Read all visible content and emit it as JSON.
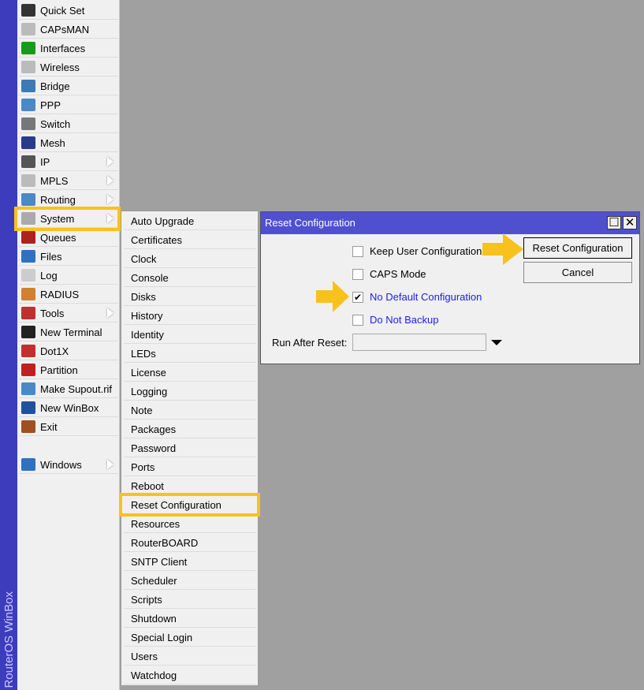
{
  "app": {
    "side_label": "RouterOS WinBox"
  },
  "menu": {
    "items": [
      {
        "label": "Quick Set",
        "icon": "wand-icon",
        "color": "#333"
      },
      {
        "label": "CAPsMAN",
        "icon": "antenna-icon",
        "color": "#bbb"
      },
      {
        "label": "Interfaces",
        "icon": "nic-icon",
        "color": "#1a9a1a"
      },
      {
        "label": "Wireless",
        "icon": "antenna-icon",
        "color": "#bbb"
      },
      {
        "label": "Bridge",
        "icon": "bridge-icon",
        "color": "#3d7ab8"
      },
      {
        "label": "PPP",
        "icon": "ppp-icon",
        "color": "#4a88c8"
      },
      {
        "label": "Switch",
        "icon": "switch-icon",
        "color": "#777"
      },
      {
        "label": "Mesh",
        "icon": "mesh-icon",
        "color": "#2a3a8a"
      },
      {
        "label": "IP",
        "icon": "ip-icon",
        "color": "#555",
        "sub": true
      },
      {
        "label": "MPLS",
        "icon": "mpls-icon",
        "color": "#bbb",
        "sub": true
      },
      {
        "label": "Routing",
        "icon": "routing-icon",
        "color": "#4a88c8",
        "sub": true
      },
      {
        "label": "System",
        "icon": "gear-icon",
        "color": "#aaa",
        "sub": true
      },
      {
        "label": "Queues",
        "icon": "queues-icon",
        "color": "#b02020"
      },
      {
        "label": "Files",
        "icon": "folder-icon",
        "color": "#3070c0"
      },
      {
        "label": "Log",
        "icon": "log-icon",
        "color": "#ccc"
      },
      {
        "label": "RADIUS",
        "icon": "users-icon",
        "color": "#d08030"
      },
      {
        "label": "Tools",
        "icon": "tools-icon",
        "color": "#c03030",
        "sub": true
      },
      {
        "label": "New Terminal",
        "icon": "terminal-icon",
        "color": "#222"
      },
      {
        "label": "Dot1X",
        "icon": "dot1x-icon",
        "color": "#c03030"
      },
      {
        "label": "Partition",
        "icon": "partition-icon",
        "color": "#c02020"
      },
      {
        "label": "Make Supout.rif",
        "icon": "supout-icon",
        "color": "#4a88c8"
      },
      {
        "label": "New WinBox",
        "icon": "winbox-icon",
        "color": "#2050a0"
      },
      {
        "label": "Exit",
        "icon": "exit-icon",
        "color": "#a05020"
      },
      {
        "label": "",
        "icon": "",
        "color": ""
      },
      {
        "label": "Windows",
        "icon": "windows-icon",
        "color": "#3070c0",
        "sub": true
      }
    ]
  },
  "submenu": {
    "items": [
      "Auto Upgrade",
      "Certificates",
      "Clock",
      "Console",
      "Disks",
      "History",
      "Identity",
      "LEDs",
      "License",
      "Logging",
      "Note",
      "Packages",
      "Password",
      "Ports",
      "Reboot",
      "Reset Configuration",
      "Resources",
      "RouterBOARD",
      "SNTP Client",
      "Scheduler",
      "Scripts",
      "Shutdown",
      "Special Login",
      "Users",
      "Watchdog"
    ]
  },
  "dialog": {
    "title": "Reset Configuration",
    "keep_user": {
      "label": "Keep User Configuration",
      "checked": false
    },
    "caps_mode": {
      "label": "CAPS Mode",
      "checked": false
    },
    "no_default": {
      "label": "No Default Configuration",
      "checked": true
    },
    "no_backup": {
      "label": "Do Not Backup",
      "checked": false
    },
    "run_after_label": "Run After Reset:",
    "run_after_value": "",
    "reset_button": "Reset Configuration",
    "cancel_button": "Cancel",
    "check_mark": "✔",
    "maximize": "☐",
    "close": "✕"
  },
  "colors": {
    "highlight": "#f8c21c",
    "titlebar": "#4f50cf",
    "link_text": "#1c1cf0"
  }
}
